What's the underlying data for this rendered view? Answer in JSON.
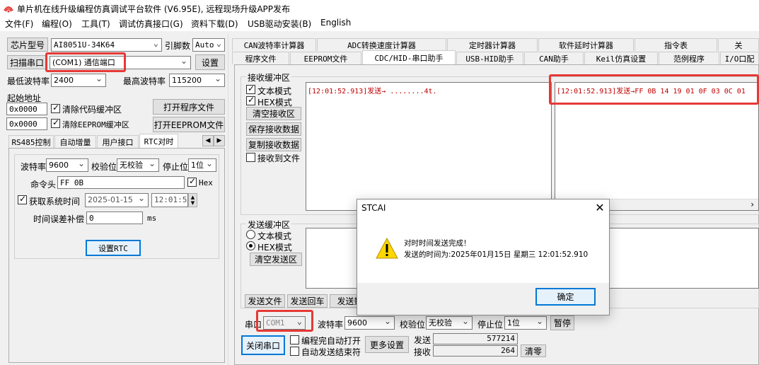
{
  "app": {
    "title": "单片机在线升级编程仿真调试平台软件 (V6.95E), 远程现场升级APP发布"
  },
  "menu": [
    "文件(F)",
    "编程(O)",
    "工具(T)",
    "调试仿真接口(G)",
    "资料下载(D)",
    "USB驱动安装(B)",
    "English"
  ],
  "left": {
    "chip_btn": "芯片型号",
    "chip_value": "AI8051U-34K64",
    "pins_label": "引脚数",
    "pins_value": "Auto",
    "scan_btn": "扫描串口",
    "port_value": "(COM1) 通信端口",
    "settings_btn": "设置",
    "min_baud_label": "最低波特率",
    "min_baud_value": "2400",
    "max_baud_label": "最高波特率",
    "max_baud_value": "115200",
    "start_addr_label": "起始地址",
    "addr1": "0x0000",
    "addr2": "0x0000",
    "clear_code_label": "清除代码缓冲区",
    "clear_eeprom_label": "清除EEPROM缓冲区",
    "open_prog_btn": "打开程序文件",
    "open_eeprom_btn": "打开EEPROM文件",
    "tabs": [
      "RS485控制",
      "自动增量",
      "用户接口",
      "RTC对时"
    ],
    "rtc": {
      "baud_label": "波特率",
      "baud_value": "9600",
      "parity_label": "校验位",
      "parity_value": "无校验",
      "stop_label": "停止位",
      "stop_value": "1位",
      "cmd_label": "命令头",
      "cmd_value": "FF 0B",
      "hex_label": "Hex",
      "get_time_label": "获取系统时间",
      "date_value": "2025-01-15",
      "time_value": "12:01:58",
      "offset_label": "时间误差补偿",
      "offset_value": "0",
      "offset_unit": "ms",
      "set_rtc_btn": "设置RTC"
    }
  },
  "right": {
    "tabs_row1": [
      "CAN波特率计算器",
      "ADC转换速度计算器",
      "定时器计算器",
      "软件延时计算器",
      "指令表",
      "关"
    ],
    "tabs_row2": [
      "程序文件",
      "EEPROM文件",
      "CDC/HID-串口助手",
      "USB-HID助手",
      "CAN助手",
      "Keil仿真设置",
      "范例程序",
      "I/O口配"
    ],
    "recv": {
      "group_label": "接收缓冲区",
      "text_mode": "文本模式",
      "hex_mode": "HEX模式",
      "clear_btn": "清空接收区",
      "save_btn": "保存接收数据",
      "copy_btn": "复制接收数据",
      "to_file": "接收到文件",
      "left_text": "[12:01:52.913]发送→  ........4t.",
      "right_text": "[12:01:52.913]发送→FF 0B 14 19 01 0F 03 0C 01"
    },
    "send": {
      "group_label": "发送缓冲区",
      "text_mode": "文本模式",
      "hex_mode": "HEX模式",
      "clear_btn": "清空发送区",
      "send_file_btn": "发送文件",
      "send_cr_btn": "发送回车",
      "send_data_btn": "发送数"
    },
    "bottom": {
      "port_label": "串口",
      "port_value": "COM1",
      "baud_label": "波特率",
      "baud_value": "9600",
      "parity_label": "校验位",
      "parity_value": "无校验",
      "stop_label": "停止位",
      "stop_value": "1位",
      "pause_btn": "暂停",
      "close_port_btn": "关闭串口",
      "auto_open_label": "编程完自动打开",
      "auto_send_label": "自动发送结束符",
      "more_btn": "更多设置",
      "send_label": "发送",
      "send_count": "577214",
      "recv_label": "接收",
      "recv_count": "264",
      "clear_btn": "清零"
    }
  },
  "dialog": {
    "title": "STCAI",
    "line1": "对时时间发送完成！",
    "line2": "发送的时间为:2025年01月15日 星期三 12:01:52.910",
    "ok_btn": "确定"
  },
  "colors": {
    "accent": "#0078d7",
    "highlight": "#e53935",
    "log_text": "#c00000"
  }
}
